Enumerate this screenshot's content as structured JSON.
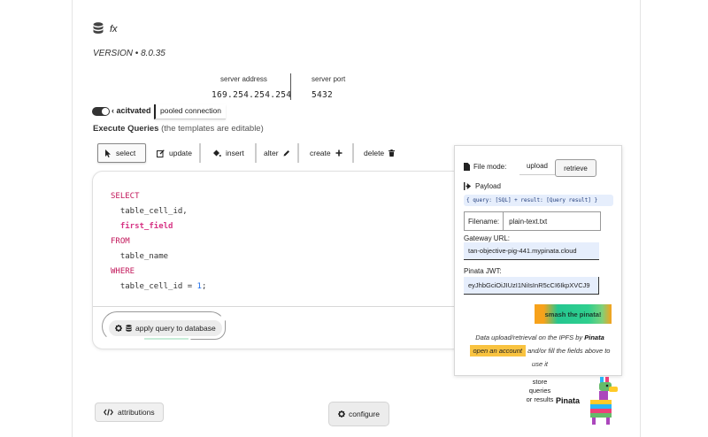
{
  "header": {
    "fx_label": "fx",
    "version": "VERSION • 8.0.35"
  },
  "server": {
    "address_label": "server address",
    "address": "169.254.254.254",
    "port_label": "server port",
    "port": "5432"
  },
  "connection": {
    "toggle_state": "on",
    "status": "acitvated",
    "mode": "pooled connection"
  },
  "execute": {
    "title": "Execute Queries",
    "note": "(the templates are editable)"
  },
  "query_types": [
    {
      "label": "select",
      "icon": "cursor-icon",
      "selected": true
    },
    {
      "label": "update",
      "icon": "edit-icon"
    },
    {
      "label": "insert",
      "icon": "paint-bucket-icon"
    },
    {
      "label": "alter",
      "icon": "pencil-icon"
    },
    {
      "label": "create",
      "icon": "plus-icon"
    },
    {
      "label": "delete",
      "icon": "trash-icon"
    }
  ],
  "editor": {
    "line1": "SELECT",
    "line2": "table_cell_id,",
    "line3": "first_field",
    "line4": "FROM",
    "line5": "table_name",
    "line6": "WHERE",
    "line7_a": "table_cell_id = ",
    "line7_num": "1",
    "line7_b": ";",
    "apply_label": "apply query to database"
  },
  "pinata_panel": {
    "file_mode_label": "File mode:",
    "tab_upload": "upload",
    "tab_retrieve": "retrieve",
    "payload_label": "Payload",
    "payload_value": "{ query: [SQL] + result: [Query result] }",
    "filename_label": "Filename:",
    "filename_value": "plain-text.txt",
    "gateway_label": "Gateway URL:",
    "gateway_value": "tan-objective-pig-441.mypinata.cloud",
    "jwt_label": "Pinata JWT:",
    "jwt_value": "eyJhbGciOiJIUzI1NiIsInR5cCI6IkpXVCJ9",
    "smash_label": "smash the pinata!",
    "info_a": "Data upload/retrieval on the IPFS by",
    "info_brand": "Pinata",
    "info_link": "open an account",
    "info_b": "and/or fill the fields above to use it"
  },
  "footer": {
    "store_text": "store queries or results",
    "pinata_brand": "Pinata",
    "attributions_label": "attributions",
    "configure_label": "configure"
  },
  "colors": {
    "keyword": "#c2185b",
    "number": "#1f6feb",
    "input_bg": "#e6eefc",
    "accent_orange": "#f7a21b",
    "accent_green": "#25c690"
  }
}
